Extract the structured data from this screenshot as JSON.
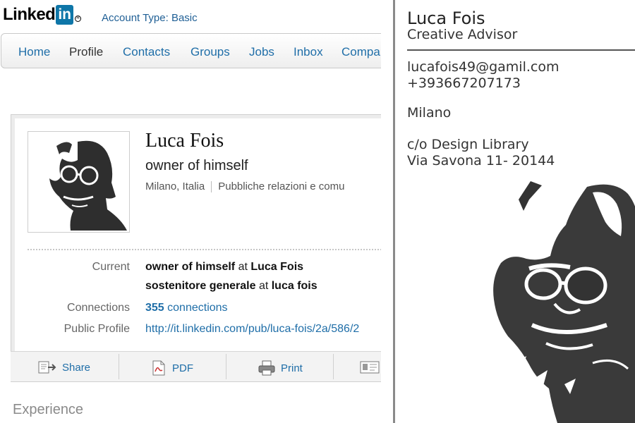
{
  "linkedin": {
    "logo_text": "Linked",
    "logo_in": "in",
    "logo_reg": "R",
    "account_type": "Account Type: Basic",
    "nav": [
      "Home",
      "Profile",
      "Contacts",
      "Groups",
      "Jobs",
      "Inbox",
      "Compa"
    ],
    "profile": {
      "name": "Luca Fois",
      "headline": "owner of himself",
      "location": "Milano, Italia",
      "industry": "Pubbliche relazioni e comu",
      "current_label": "Current",
      "current_1_role": "owner of himself",
      "current_1_at": " at ",
      "current_1_org": "Luca Fois",
      "current_2_role": "sostenitore generale",
      "current_2_at": " at ",
      "current_2_org": "luca fois",
      "connections_label": "Connections",
      "connections_count": "355",
      "connections_word": " connections",
      "public_label": "Public Profile",
      "public_url": "http://it.linkedin.com/pub/luca-fois/2a/586/2"
    },
    "actions": {
      "share": "Share",
      "pdf": "PDF",
      "print": "Print"
    },
    "section_title": "Experience"
  },
  "business_card": {
    "name": "Luca Fois",
    "role": "Creative Advisor",
    "email": "lucafois49@gamil.com",
    "phone": "+393667207173",
    "city": "Milano",
    "address_1": "c/o Design Library",
    "address_2": "Via Savona 11- 20144"
  },
  "colors": {
    "link": "#1f6ea8",
    "linkedin_blue": "#0e76a8",
    "text_dark": "#222222",
    "divider": "#8a8a8a"
  }
}
